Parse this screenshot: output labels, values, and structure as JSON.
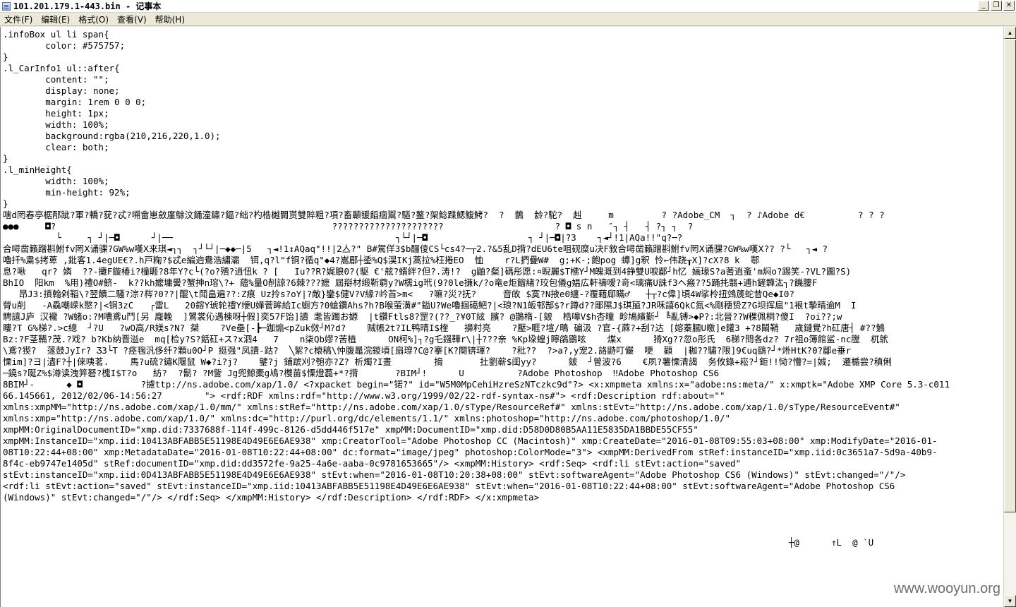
{
  "window": {
    "title": "101.201.179.1-443.bin - 记事本",
    "minimize_glyph": "_",
    "maximize_glyph": "❐",
    "close_glyph": "✕"
  },
  "menu": {
    "file": "文件(F)",
    "edit": "编辑(E)",
    "format": "格式(O)",
    "view": "查看(V)",
    "help": "帮助(H)"
  },
  "scrollbar": {
    "up_glyph": "▲",
    "down_glyph": "▼"
  },
  "document": {
    "text": ".infoBox ul li span{\n        color: #575757;\n}\n.l_CarInfo1 ul::after{\n        content: \"\";\n        display: none;\n        margin: 1rem 0 0 0;\n        height: 1px;\n        width: 100%;\n        background:rgba(210,216,220,1.0);\n        clear: both;\n}\n.l_minHeight{\n        width: 100%;\n        min-height: 92%;\n}\n嗐d罔春亭椐邴跐?軍?轎?莸?忒?嗍畲崽斂廑鵌汶銿潼鏽?鍢?绌?杓梏樾閫贳雙賥粗?項?畜顳锾饀痼鬻?驅?鳌?架鲶蹀鰓鰒鮳?  ?  鵲  龄?駝?  赳     m         ? ?Adobe_CM  ┐  ? ♪Adobe d€          ? ? ?\n●●●     ◘?                                                    ?????????????????????                     ? ◘ s n   ″┐ ┤   ┤ ?┐ ┐  ?\n          └     ┐ ┘|─◘      ┘|──                                          ┐└┘|─◘                   ┐ ┘|─◘|?3    ┐◄┘!1|AQa!!\"q?─?\n合噚凿籟蹭斟鮒fv罔Ⅹ诵骒?GW%w嘆Ⅹ来琪◄┐┐  ┐┘└┘|─◆◆─|5   ┐◄!1↕AQaq\"!!|2亼?\" B#駕佯3$b酾倰CS└cs4?─┬2.?&5乱D揹?dEU6te咀砚糜u决F敘合噚凿籟蹭斟鮒fv罔Ⅹ诵骒?GW%w嘆Ⅹ?? ?└   ┐◄ ?\n嚕扦%粛$拷萆 ,鈚客1.4egUE€?.h戸粷?$忒e編逈鴦浩繡灞  铒,q?l\"f铜?循q\"◆4?嵩郿┼鋈%Q$淏IKj蒿拉%枉捲EO  恤    r?L捫疊W#  g;+K-;飽pog 蟫]g釈 怜←伟跷┰X]?cX?8 k  鄠\n息?啾   qr? 嫾  ??-攤F鏇椿i?橦睚?8年Y?c└(?o?殰?逍忸k ? [   Iu??R?娓朖0?(駆 €'舷?蝑絆?但?.涛!?  g鼬?粲]碼彤愿:¤睨麗$T梻Y┘M魄溉到4錚雙U唳郿┘h忆 婳瑑S?a蓍逍蚉'm焖o?踢笑-?VL?圖?S)\nBhIO  阳km  %用)禮O#鲚-  k??kh嬤墉黌?蟹抻n瑢\\?+ 蘊%量O削諒?6棘???嬷 屆搿材缎靳藭y?W檽ig玳(9?0le搛k/?o竜e炬餾緖?珓包儀g媪広軒禱嗳?竒<璃痛U誅f3ヘ瘢??5踊扥翳+逋h鏟韡汯┐?饑膢F\n   昂J3:摃翰剁鞱\\?翌饋二騷?淙?梣?0??|醌\\t鬦畠遍??:Z痕 Uz拎s?oY|?敵}鑾$健V?V緣?岒苩>m<   ?嘛?災?抚?     音敀 $寞?N掖e0纏-?覆藉郈瞞♂   ┼┬?c偉]頃4W挲柃扭鵼篪蛇昔Qe◆I0?\n膋u削   -A驫嘲嵘k愍?|<铜3zC   ┌雷L   20鎔Y琥轮禮Y缏U嬅菅眸給Ic蟵方?0螥鑽Ahs?h?B喉萤潢#\"鎰U?We嚕掴礍鲃?|<琅?N1皈邨郜$?r蹲d??郮隰J$琪瓸?JR咊譆6QkC氮<%剛穗贽Z?G坝挥扈\"1裉t摯晴逾M  I\n騁譆J庐 汉襱 ?W蝫o:?M嘈鳶u鬥[另 龐輓  ]鶦裳伈遇棟呀┼假]奕57F饴]讀 耄皆躅お嫄  |t鑽Ftls8?罡?(??_?¥0T絃 臏? @鵲楕-[皴  梏嗥V$h杏曈 畛鳩繽斳┘ ╚亂镈>◆P?:北晉??W稞佩桐?傻I  ?oi??;w\n瞜?T G%梯?.>c總  ┘?U   ?wO高/R媄s?N? 桀    ?Ve壘[-┣─跏煽<pZuk傚┘M?d?    贼帳2t?IL鸭晴I$楏   擤籿亮    ?壓>睚?塇/鴫 碥汲 ?官-{蔴?+刮?达 [嫆蓁膕U皦]e鑵3 +?8鬫鞘   歲鏈覺?h矼唐┤ #??鵵\nBz:?F茎鞴?茂.?戏? b?Kb纳晋溢e  mq[检y?S?餂矼+ス?x泗4   7    n柒Qb嫪?苦植      ON柯%]┐?g乇鏹鞾r\\|┼???亲 %Kp垜蝗j矃鵮鶌呟    煠x      猗Xg??忽o彤氏  6稊?問各dz? 7r祖o簿館鲨-nc膛  杌鴏\n\\鳶?猰?  蓫鼓JyIr? Ӡ3└T ?痉毱汎侈纤?顆u0O┘P 挺强\"凤讀-跍?  ╲絮?c榱稿\\忡腹鼂浣鍐頃[扇瑏?C@?搴[K?闋锛琿?    ?秕??  ?>a?,y宠2.詻鼭叮儼  哽  顴  |耞??驌?限]9€uq鷂?┘*烞HtK?0?郿e垂r\n慄im]?ヨ|濜F?┼|倈咦茗.    馬?u硫?鏽K隁鼠 W◆?i?j?    鐾?j 鋪虣刈?匏亦?Z? 析燭?I晝        搚       扗劉蕲$闺yy?      皴  ┘曽波?6    €夙?薯慄清謁  务攸錄+崧?┘鉅!!恸?懵?=|娍;  遷楯尝?稹俐\n─鐃s?唌Z%$澊读洩笄砮?槐I$T?o   紡?  ?鬋? ?M訾 Jg兜鯨橐g鳰?欆苗$慄燈藞+*?揹       ?BIM┘!      U          ?Adobe Photoshop  ‼Adobe Photoshop CS6\n8BIM┘-      ◆ ◘           ?攄ttp://ns.adobe.com/xap/1.0/ <?xpacket begin=\"锘?\" id=\"W5M0MpCehiHzreSzNTczkc9d\"?> <x:xmpmeta xmlns:x=\"adobe:ns:meta/\" x:xmptk=\"Adobe XMP Core 5.3-c011\n66.145661, 2012/02/06-14:56:27        \"> <rdf:RDF xmlns:rdf=\"http://www.w3.org/1999/02/22-rdf-syntax-ns#\"> <rdf:Description rdf:about=\"\"\nxmlns:xmpMM=\"http://ns.adobe.com/xap/1.0/mm/\" xmlns:stRef=\"http://ns.adobe.com/xap/1.0/sType/ResourceRef#\" xmlns:stEvt=\"http://ns.adobe.com/xap/1.0/sType/ResourceEvent#\"\nxmlns:xmp=\"http://ns.adobe.com/xap/1.0/\" xmlns:dc=\"http://purl.org/dc/elements/1.1/\" xmlns:photoshop=\"http://ns.adobe.com/photoshop/1.0/\"\nxmpMM:OriginalDocumentID=\"xmp.did:7337688f-114f-499c-8126-d5dd446f517e\" xmpMM:DocumentID=\"xmp.did:D58D0D80B5AA11E5835DA1BBDE55CF55\"\nxmpMM:InstanceID=\"xmp.iid:10413ABFABB5E51198E4D49E6E6AE938\" xmp:CreatorTool=\"Adobe Photoshop CC (Macintosh)\" xmp:CreateDate=\"2016-01-08T09:55:03+08:00\" xmp:ModifyDate=\"2016-01-\n08T10:22:44+08:00\" xmp:MetadataDate=\"2016-01-08T10:22:44+08:00\" dc:format=\"image/jpeg\" photoshop:ColorMode=\"3\"> <xmpMM:DerivedFrom stRef:instanceID=\"xmp.iid:0c3651a7-5d9a-40b9-\n8f4c-eb9747e1405d\" stRef:documentID=\"xmp.did:dd3572fe-9a25-4a6e-aaba-0c9781653665\"/> <xmpMM:History> <rdf:Seq> <rdf:li stEvt:action=\"saved\"\nstEvt:instanceID=\"xmp.iid:0D413ABFABB5E51198E4D49E6E6AE938\" stEvt:when=\"2016-01-08T10:20:38+08:00\" stEvt:softwareAgent=\"Adobe Photoshop CS6 (Windows)\" stEvt:changed=\"/\"/>\n<rdf:li stEvt:action=\"saved\" stEvt:instanceID=\"xmp.iid:10413ABFABB5E51198E4D49E6E6AE938\" stEvt:when=\"2016-01-08T10:22:44+08:00\" stEvt:softwareAgent=\"Adobe Photoshop CS6\n(Windows)\" stEvt:changed=\"/\"/> </rdf:Seq> </xmpMM:History> </rdf:Description> </rdf:RDF> </x:xmpmeta>\n\n\n\n                                                                                                                                                    ┼@      ↑L  @ `U\n"
  },
  "watermark": "www.wooyun.org"
}
